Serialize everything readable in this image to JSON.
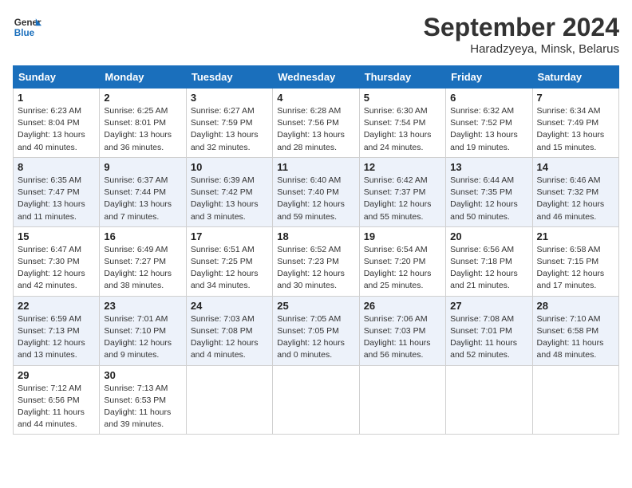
{
  "header": {
    "logo_line1": "General",
    "logo_line2": "Blue",
    "month": "September 2024",
    "location": "Haradzyeya, Minsk, Belarus"
  },
  "days_of_week": [
    "Sunday",
    "Monday",
    "Tuesday",
    "Wednesday",
    "Thursday",
    "Friday",
    "Saturday"
  ],
  "weeks": [
    [
      {
        "day": "1",
        "sunrise": "6:23 AM",
        "sunset": "8:04 PM",
        "daylight": "13 hours and 40 minutes."
      },
      {
        "day": "2",
        "sunrise": "6:25 AM",
        "sunset": "8:01 PM",
        "daylight": "13 hours and 36 minutes."
      },
      {
        "day": "3",
        "sunrise": "6:27 AM",
        "sunset": "7:59 PM",
        "daylight": "13 hours and 32 minutes."
      },
      {
        "day": "4",
        "sunrise": "6:28 AM",
        "sunset": "7:56 PM",
        "daylight": "13 hours and 28 minutes."
      },
      {
        "day": "5",
        "sunrise": "6:30 AM",
        "sunset": "7:54 PM",
        "daylight": "13 hours and 24 minutes."
      },
      {
        "day": "6",
        "sunrise": "6:32 AM",
        "sunset": "7:52 PM",
        "daylight": "13 hours and 19 minutes."
      },
      {
        "day": "7",
        "sunrise": "6:34 AM",
        "sunset": "7:49 PM",
        "daylight": "13 hours and 15 minutes."
      }
    ],
    [
      {
        "day": "8",
        "sunrise": "6:35 AM",
        "sunset": "7:47 PM",
        "daylight": "13 hours and 11 minutes."
      },
      {
        "day": "9",
        "sunrise": "6:37 AM",
        "sunset": "7:44 PM",
        "daylight": "13 hours and 7 minutes."
      },
      {
        "day": "10",
        "sunrise": "6:39 AM",
        "sunset": "7:42 PM",
        "daylight": "13 hours and 3 minutes."
      },
      {
        "day": "11",
        "sunrise": "6:40 AM",
        "sunset": "7:40 PM",
        "daylight": "12 hours and 59 minutes."
      },
      {
        "day": "12",
        "sunrise": "6:42 AM",
        "sunset": "7:37 PM",
        "daylight": "12 hours and 55 minutes."
      },
      {
        "day": "13",
        "sunrise": "6:44 AM",
        "sunset": "7:35 PM",
        "daylight": "12 hours and 50 minutes."
      },
      {
        "day": "14",
        "sunrise": "6:46 AM",
        "sunset": "7:32 PM",
        "daylight": "12 hours and 46 minutes."
      }
    ],
    [
      {
        "day": "15",
        "sunrise": "6:47 AM",
        "sunset": "7:30 PM",
        "daylight": "12 hours and 42 minutes."
      },
      {
        "day": "16",
        "sunrise": "6:49 AM",
        "sunset": "7:27 PM",
        "daylight": "12 hours and 38 minutes."
      },
      {
        "day": "17",
        "sunrise": "6:51 AM",
        "sunset": "7:25 PM",
        "daylight": "12 hours and 34 minutes."
      },
      {
        "day": "18",
        "sunrise": "6:52 AM",
        "sunset": "7:23 PM",
        "daylight": "12 hours and 30 minutes."
      },
      {
        "day": "19",
        "sunrise": "6:54 AM",
        "sunset": "7:20 PM",
        "daylight": "12 hours and 25 minutes."
      },
      {
        "day": "20",
        "sunrise": "6:56 AM",
        "sunset": "7:18 PM",
        "daylight": "12 hours and 21 minutes."
      },
      {
        "day": "21",
        "sunrise": "6:58 AM",
        "sunset": "7:15 PM",
        "daylight": "12 hours and 17 minutes."
      }
    ],
    [
      {
        "day": "22",
        "sunrise": "6:59 AM",
        "sunset": "7:13 PM",
        "daylight": "12 hours and 13 minutes."
      },
      {
        "day": "23",
        "sunrise": "7:01 AM",
        "sunset": "7:10 PM",
        "daylight": "12 hours and 9 minutes."
      },
      {
        "day": "24",
        "sunrise": "7:03 AM",
        "sunset": "7:08 PM",
        "daylight": "12 hours and 4 minutes."
      },
      {
        "day": "25",
        "sunrise": "7:05 AM",
        "sunset": "7:05 PM",
        "daylight": "12 hours and 0 minutes."
      },
      {
        "day": "26",
        "sunrise": "7:06 AM",
        "sunset": "7:03 PM",
        "daylight": "11 hours and 56 minutes."
      },
      {
        "day": "27",
        "sunrise": "7:08 AM",
        "sunset": "7:01 PM",
        "daylight": "11 hours and 52 minutes."
      },
      {
        "day": "28",
        "sunrise": "7:10 AM",
        "sunset": "6:58 PM",
        "daylight": "11 hours and 48 minutes."
      }
    ],
    [
      {
        "day": "29",
        "sunrise": "7:12 AM",
        "sunset": "6:56 PM",
        "daylight": "11 hours and 44 minutes."
      },
      {
        "day": "30",
        "sunrise": "7:13 AM",
        "sunset": "6:53 PM",
        "daylight": "11 hours and 39 minutes."
      },
      null,
      null,
      null,
      null,
      null
    ]
  ],
  "labels": {
    "sunrise": "Sunrise:",
    "sunset": "Sunset:",
    "daylight": "Daylight:"
  }
}
